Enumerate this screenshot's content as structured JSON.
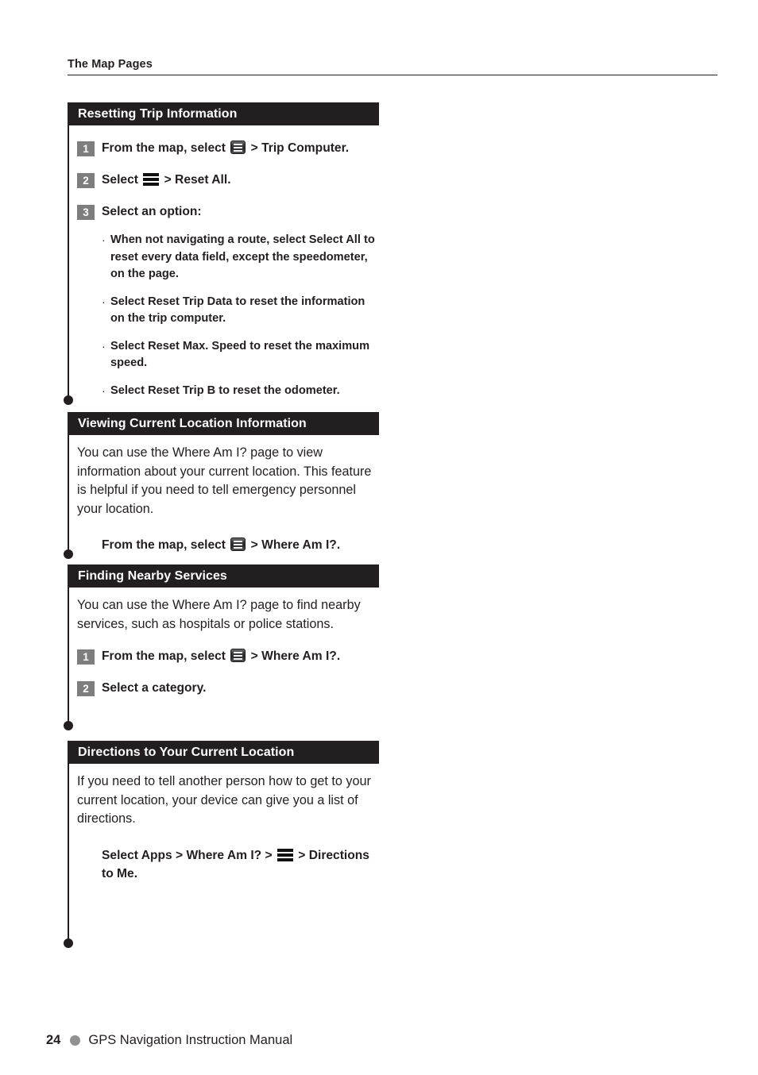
{
  "running_head": {
    "text": "The Map Pages"
  },
  "sections": [
    {
      "id": "resetting-trip-information",
      "title": "Resetting Trip Information",
      "steps": [
        {
          "num": "1",
          "pre": "From the map, select ",
          "icon": "menu-button-icon",
          "post": " > Trip Computer."
        },
        {
          "num": "2",
          "pre": "Select ",
          "icon": "hamburger-icon",
          "post": " > Reset All."
        },
        {
          "num": "3",
          "pre": "Select an option:",
          "icon": null,
          "post": ""
        }
      ],
      "bullets": [
        {
          "mark": "·",
          "lead": "When not navigating a route, select ",
          "strong": "Select All",
          "tail": " to reset every data field, except the speedometer, on the page."
        },
        {
          "mark": "·",
          "lead": "Select ",
          "strong": "Reset Trip Data",
          "tail": " to reset the information on the trip computer."
        },
        {
          "mark": "·",
          "lead": "Select ",
          "strong": "Reset Max. Speed",
          "tail": " to reset the maximum speed."
        },
        {
          "mark": "·",
          "lead": "Select ",
          "strong": "Reset Trip B",
          "tail": " to reset the odometer."
        }
      ]
    },
    {
      "id": "viewing-current-location-information",
      "title": "Viewing Current Location Information",
      "paragraph": "You can use the Where Am I? page to view information about your current location. This feature is helpful if you need to tell emergency personnel your location.",
      "instruction": {
        "pre": "From the map, select ",
        "icon": "menu-button-icon",
        "post": " > Where Am I?."
      }
    },
    {
      "id": "finding-nearby-services",
      "title": "Finding Nearby Services",
      "paragraph": "You can use the Where Am I? page to find nearby services, such as hospitals or police stations.",
      "steps": [
        {
          "num": "1",
          "pre": "From the map, select ",
          "icon": "menu-button-icon",
          "post": " > Where Am I?."
        },
        {
          "num": "2",
          "pre": "Select a category.",
          "icon": null,
          "post": ""
        }
      ]
    },
    {
      "id": "directions-to-your-current-location",
      "title": "Directions to Your Current Location",
      "paragraph": "If you need to tell another person how to get to your current location, your device can give you a list of directions.",
      "instruction": {
        "pre": "Select Apps > Where Am I? > ",
        "icon": "hamburger-icon",
        "post": " > Directions to Me."
      }
    }
  ],
  "footer": {
    "page_number": "24",
    "manual_title": "GPS Navigation Instruction Manual",
    "dot_color": "#919191"
  },
  "colors": {
    "header_bar": "#231f20",
    "step_badge": "#7e7e7e",
    "text": "#231f20"
  }
}
